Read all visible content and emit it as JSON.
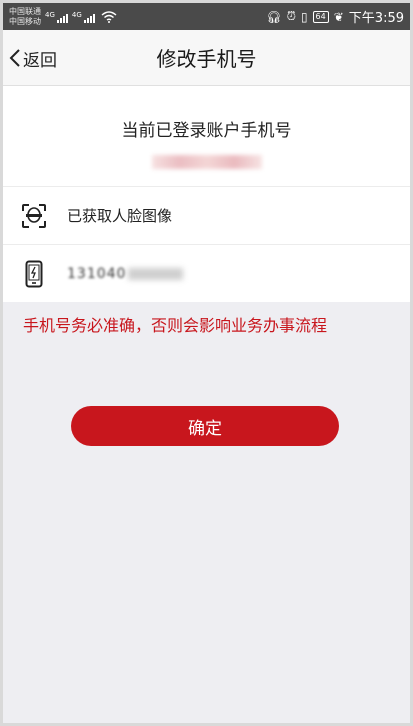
{
  "status_bar": {
    "carrier_1": "中国联通",
    "carrier_2": "中国移动",
    "net_tag_1": "4G",
    "net_tag_2": "4G",
    "battery": "64",
    "time": "下午3:59"
  },
  "nav": {
    "back_label": "返回",
    "title": "修改手机号"
  },
  "account": {
    "label": "当前已登录账户手机号"
  },
  "face_row": {
    "icon": "face-scan-icon",
    "text": "已获取人脸图像"
  },
  "phone_row": {
    "icon": "mobile-phone-icon",
    "value_prefix": "131040"
  },
  "warning": "手机号务必准确，否则会影响业务办事流程",
  "confirm_label": "确定",
  "colors": {
    "accent": "#c8161d",
    "background": "#eeeef2",
    "status_bar": "#4a4a4a"
  }
}
